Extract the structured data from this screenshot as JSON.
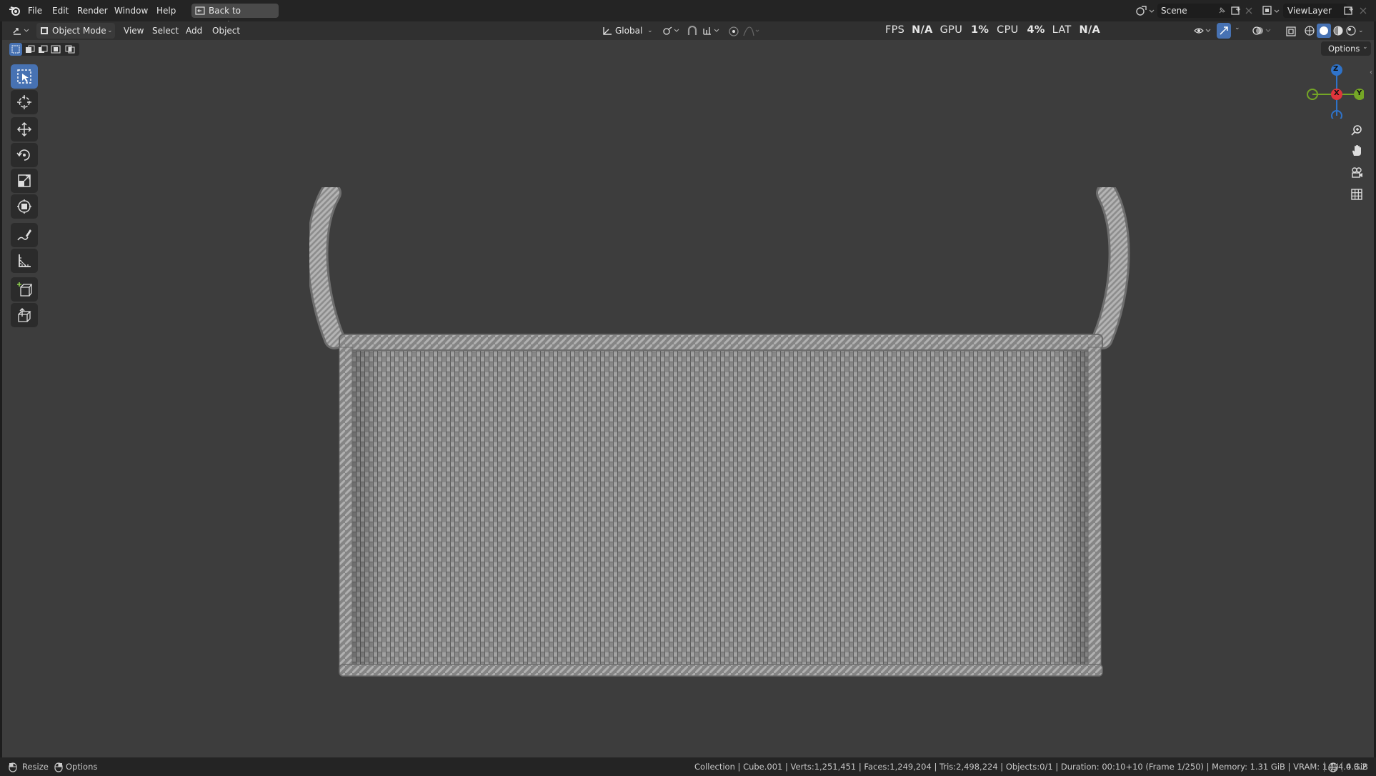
{
  "topbar": {
    "menus": [
      "File",
      "Edit",
      "Render",
      "Window",
      "Help"
    ],
    "back_button": "Back to Previous",
    "scene_name": "Scene",
    "view_layer": "ViewLayer"
  },
  "header": {
    "mode": "Object Mode",
    "menus": [
      "View",
      "Select",
      "Add",
      "Object"
    ],
    "orientation": "Global",
    "options": "Options"
  },
  "perf": {
    "fps_label": "FPS",
    "fps_value": "N/A",
    "gpu_label": "GPU",
    "gpu_value": "1%",
    "cpu_label": "CPU",
    "cpu_value": "4%",
    "lat_label": "LAT",
    "lat_value": "N/A"
  },
  "gizmo": {
    "z": "Z",
    "x": "X",
    "y": "Y"
  },
  "tools": [
    "select-box",
    "cursor",
    "move",
    "rotate",
    "scale",
    "transform",
    "annotate",
    "measure",
    "add-cube",
    "extrude"
  ],
  "statusbar": {
    "resize": "Resize",
    "options": "Options",
    "info": "Collection | Cube.001 | Verts:1,251,451 | Faces:1,249,204 | Tris:2,498,224 | Objects:0/1 | Duration: 00:10+10 (Frame 1/250) | Memory: 1.31 GiB | VRAM: 1.1/4.0 GiB",
    "version": "4.3.2"
  },
  "colors": {
    "accent": "#4772b3",
    "axis_x": "#e0353b",
    "axis_y": "#75a626",
    "axis_z": "#2f73c9",
    "viewport": "#3d3d3d"
  }
}
